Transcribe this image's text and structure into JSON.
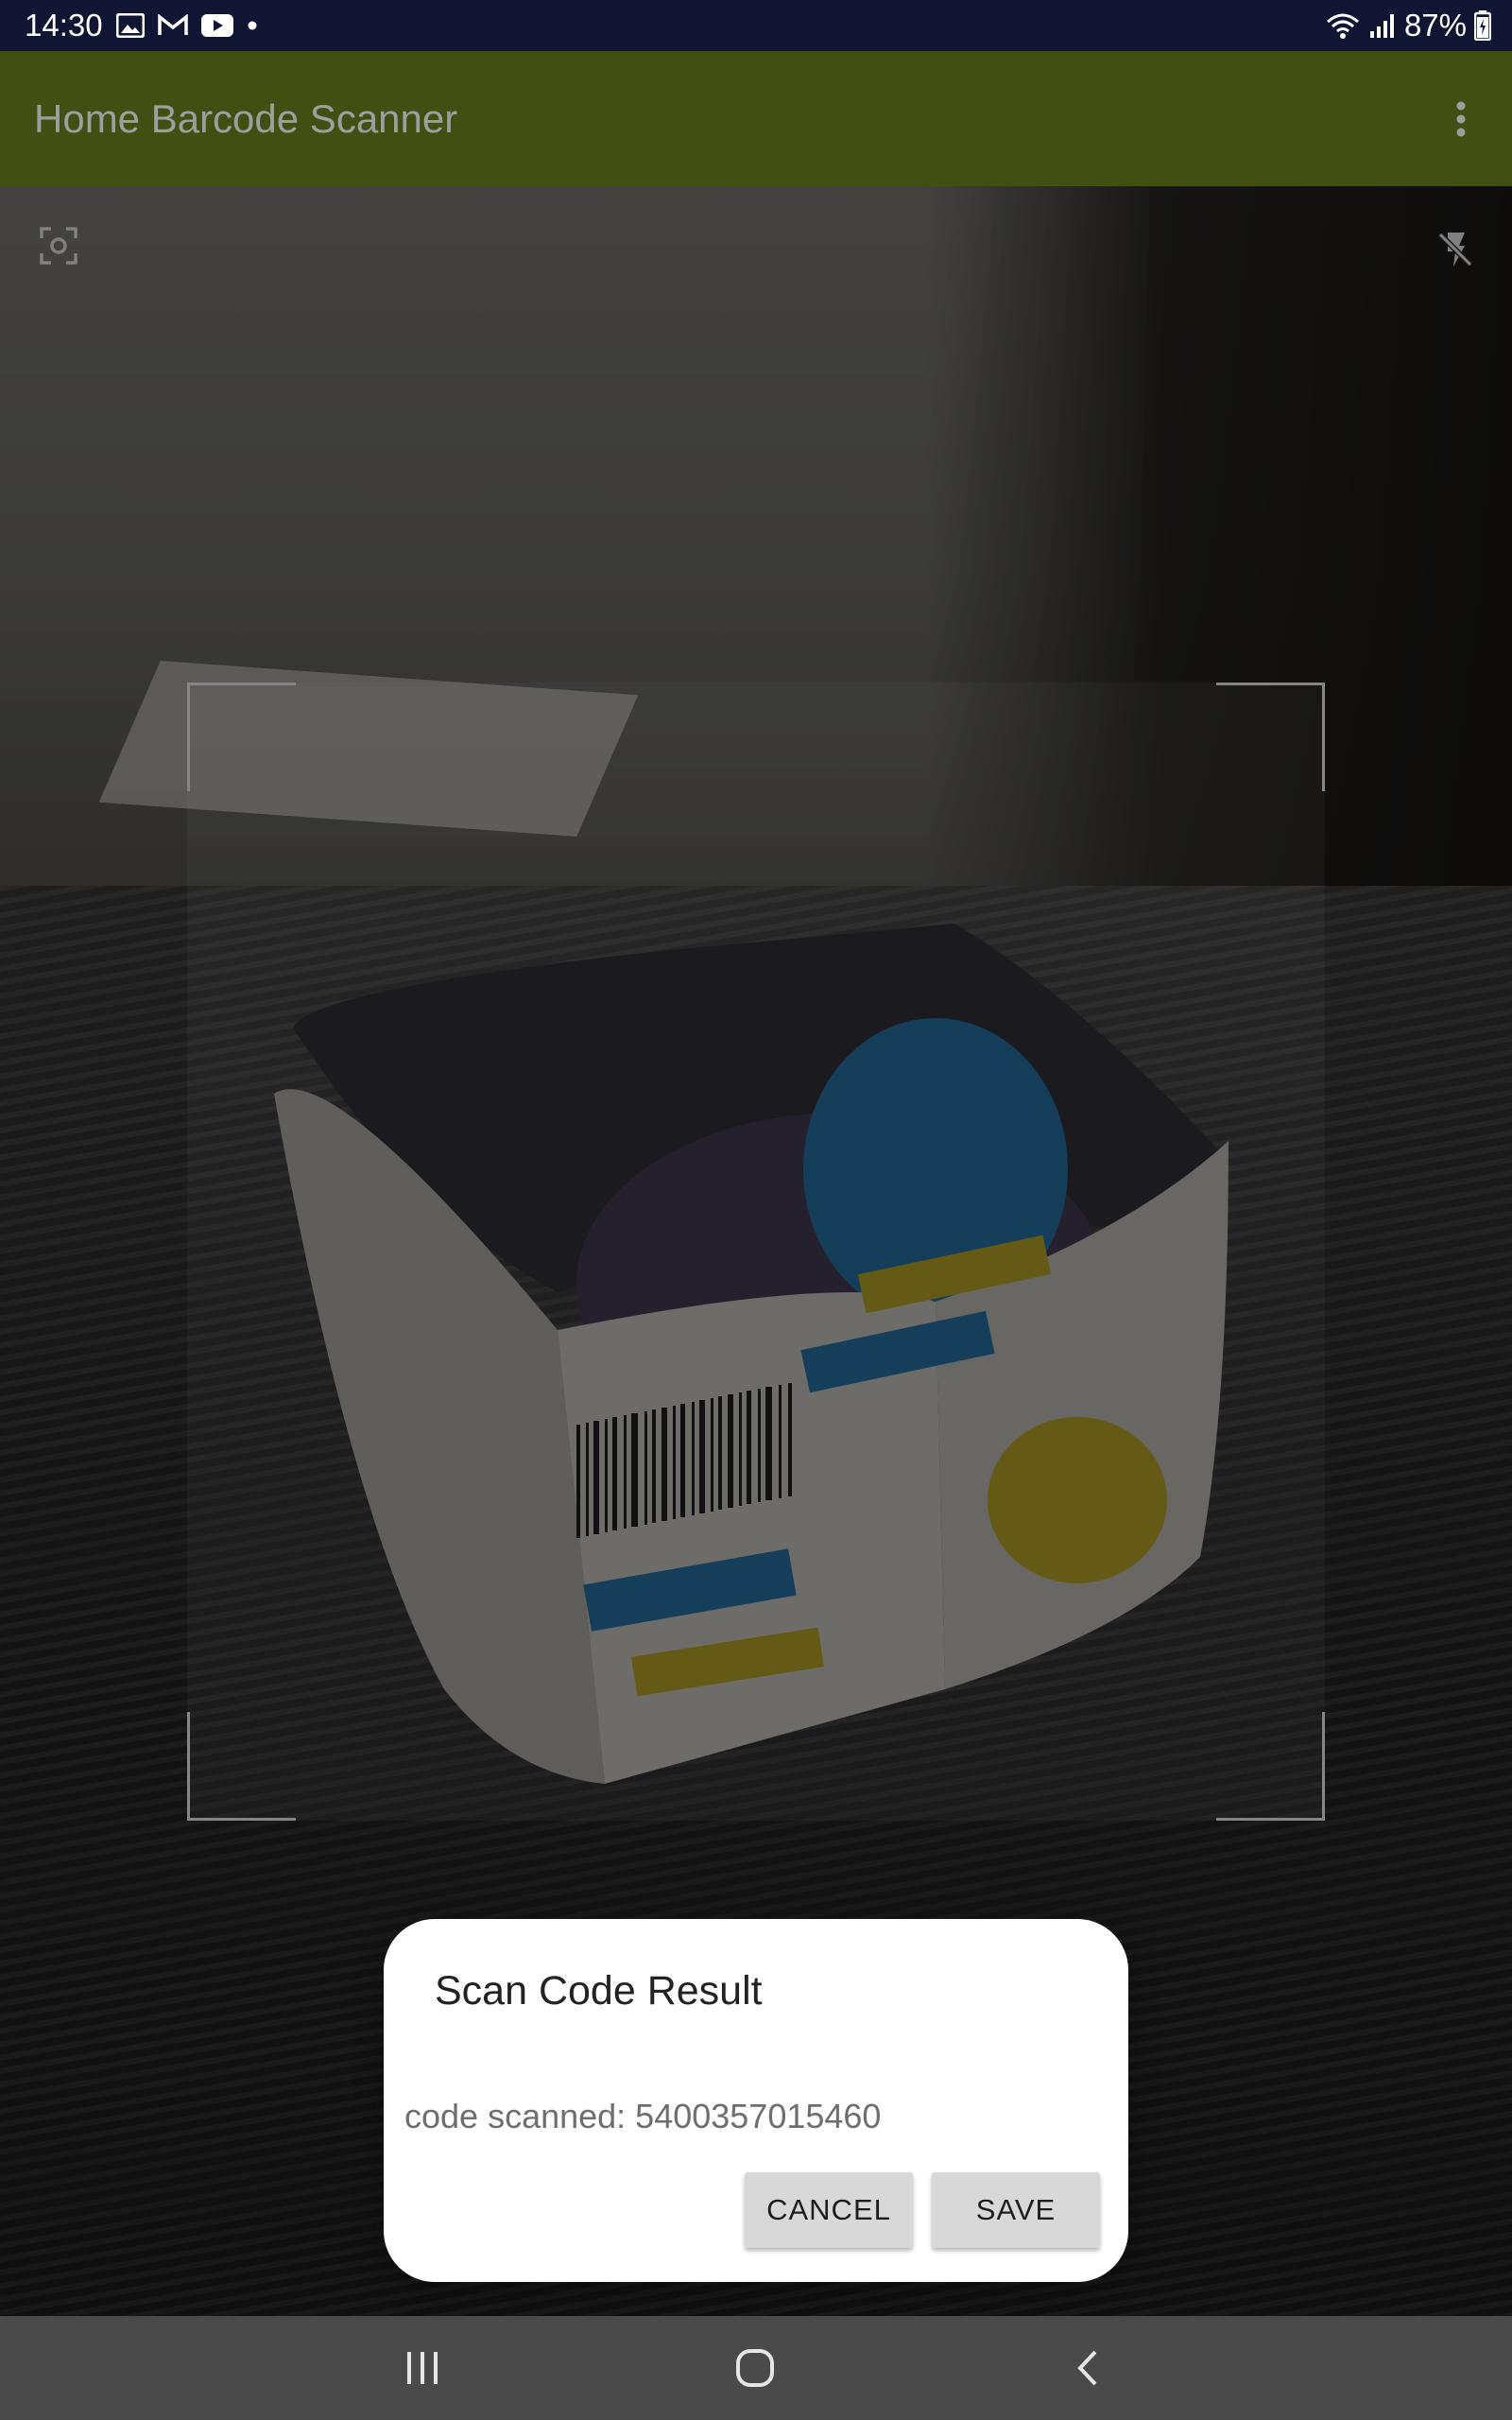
{
  "status_bar": {
    "time": "14:30",
    "battery": "87%",
    "notification_icons": [
      "gallery-icon",
      "gmail-icon",
      "youtube-icon",
      "dot-icon"
    ],
    "system_icons": [
      "wifi-icon",
      "signal-icon",
      "battery-icon"
    ]
  },
  "app_bar": {
    "title": "Home Barcode Scanner",
    "overflow_icon": "more-vert-icon"
  },
  "camera": {
    "focus_icon": "center-focus-icon",
    "flash_icon": "flash-off-icon"
  },
  "dialog": {
    "title": "Scan Code Result",
    "message": "code scanned: 5400357015460",
    "cancel_label": "CANCEL",
    "save_label": "SAVE"
  },
  "nav_bar": {
    "recents_icon": "recents-icon",
    "home_icon": "home-icon",
    "back_icon": "back-icon"
  },
  "colors": {
    "status_bar": "#0f1533",
    "app_bar": "#6b7f1e",
    "dialog_bg": "#ffffff",
    "button_bg": "#d8d8d8",
    "nav_bar": "#4a4a4a"
  }
}
